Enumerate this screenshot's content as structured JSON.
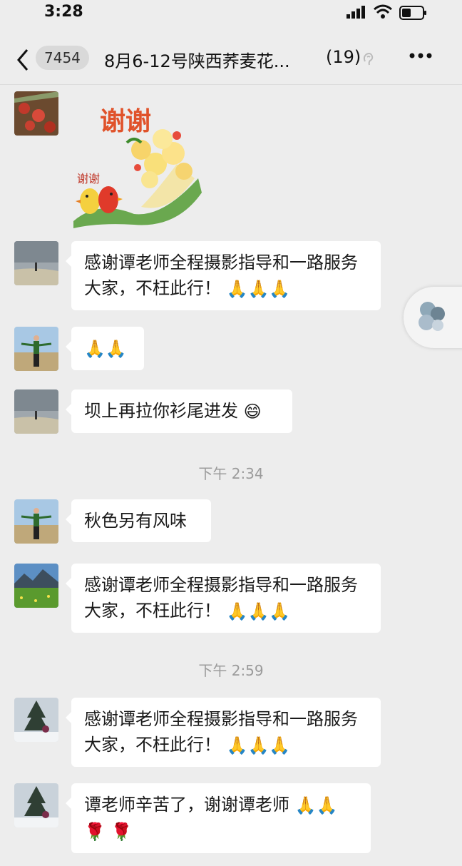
{
  "status": {
    "time": "3:28"
  },
  "header": {
    "unread_count": "7454",
    "title": "8月6-12号陕西荞麦花...",
    "member_count": "(19)"
  },
  "messages": [
    {
      "type": "sticker",
      "sticker_text_big": "谢谢",
      "sticker_text_small": "谢谢"
    },
    {
      "type": "text",
      "text": "感谢谭老师全程摄影指导和一路服务大家，不枉此行！"
    },
    {
      "type": "text",
      "text": ""
    },
    {
      "type": "text",
      "text": "坝上再拉你衫尾进发"
    },
    {
      "type": "time",
      "text": "下午 2:34"
    },
    {
      "type": "text",
      "text": "秋色另有风味"
    },
    {
      "type": "text",
      "text": "感谢谭老师全程摄影指导和一路服务大家，不枉此行！"
    },
    {
      "type": "time",
      "text": "下午 2:59"
    },
    {
      "type": "text",
      "text": "感谢谭老师全程摄影指导和一路服务大家，不枉此行！"
    },
    {
      "type": "text",
      "text": "谭老师辛苦了，谢谢谭老师"
    }
  ]
}
